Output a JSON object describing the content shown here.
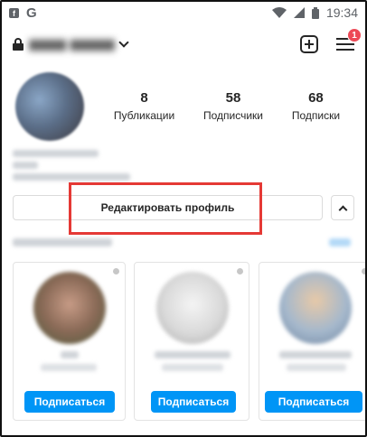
{
  "status_bar": {
    "time": "19:34",
    "icons": [
      "facebook-icon",
      "google-icon",
      "wifi-icon",
      "signal-icon",
      "battery-icon"
    ]
  },
  "header": {
    "icons": [
      "lock-icon",
      "chevron-down-icon",
      "new-post-icon",
      "menu-icon"
    ],
    "notification_count": "1"
  },
  "profile": {
    "stats": [
      {
        "value": "8",
        "label": "Публикации"
      },
      {
        "value": "58",
        "label": "Подписчики"
      },
      {
        "value": "68",
        "label": "Подписки"
      }
    ],
    "edit_button": "Редактировать профиль"
  },
  "suggestions": {
    "cards": [
      {
        "follow_label": "Подписаться"
      },
      {
        "follow_label": "Подписаться"
      },
      {
        "follow_label": "Подписаться"
      }
    ]
  },
  "colors": {
    "accent": "#0095f6",
    "badge": "#ed4956",
    "highlight": "#e53935",
    "text": "#262626"
  }
}
